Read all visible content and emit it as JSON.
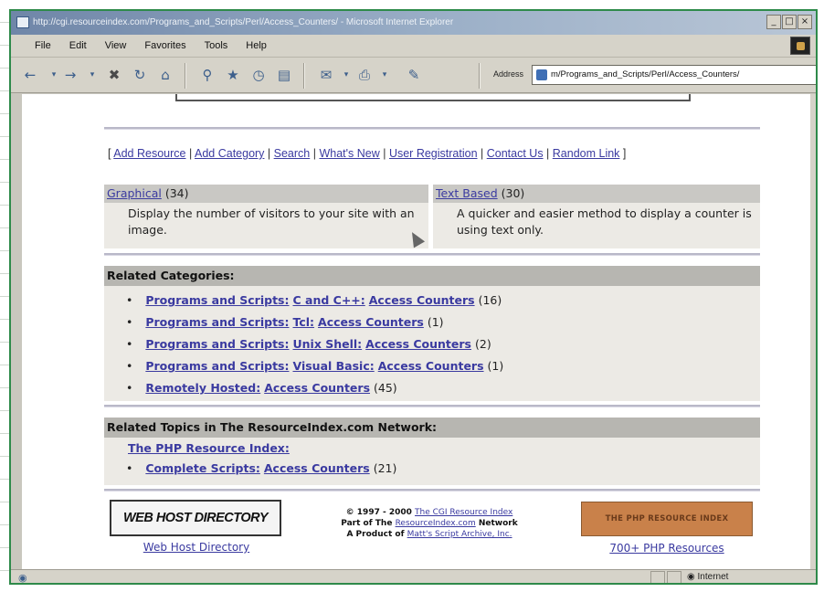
{
  "window": {
    "title": "http://cgi.resourceindex.com/Programs_and_Scripts/Perl/Access_Counters/ - Microsoft Internet Explorer",
    "controls": [
      "_",
      "□",
      "×"
    ]
  },
  "menu": [
    "File",
    "Edit",
    "View",
    "Favorites",
    "Tools",
    "Help"
  ],
  "toolbar": {
    "address_label": "Address",
    "address_value": "m/Programs_and_Scripts/Perl/Access_Counters/"
  },
  "nav_links": {
    "add_resource": "Add Resource",
    "add_category": "Add Category",
    "search": "Search",
    "whats_new": "What's New",
    "user_registration": "User Registration",
    "contact_us": "Contact Us",
    "random_link": "Random Link"
  },
  "categories": [
    {
      "name": "Graphical",
      "count": "(34)",
      "description": "Display the number of visitors to your site with an image."
    },
    {
      "name": "Text Based",
      "count": "(30)",
      "description": "A quicker and easier method to display a counter is using text only."
    }
  ],
  "related_categories": {
    "heading": "Related Categories:",
    "items": [
      {
        "parent": "Programs and Scripts:",
        "sub": "C and C++:",
        "link": "Access Counters",
        "count": "(16)"
      },
      {
        "parent": "Programs and Scripts:",
        "sub": "Tcl:",
        "link": "Access Counters",
        "count": "(1)"
      },
      {
        "parent": "Programs and Scripts:",
        "sub": "Unix Shell:",
        "link": "Access Counters",
        "count": "(2)"
      },
      {
        "parent": "Programs and Scripts:",
        "sub": "Visual Basic:",
        "link": "Access Counters",
        "count": "(1)"
      },
      {
        "parent": "Remotely Hosted:",
        "sub": "",
        "link": "Access Counters",
        "count": "(45)"
      }
    ]
  },
  "related_topics": {
    "heading": "Related Topics in The ResourceIndex.com Network:",
    "site": "The PHP Resource Index:",
    "items": [
      {
        "parent": "Complete Scripts:",
        "link": "Access Counters",
        "count": "(21)"
      }
    ]
  },
  "footer": {
    "left_logo": "WEB HOST DIRECTORY",
    "left_caption": "Web Host Directory",
    "copyright": "© 1997 - 2000",
    "copyright_link": "The CGI Resource Index",
    "part_of": "Part of The",
    "part_of_link": "ResourceIndex.com",
    "network": "Network",
    "product_of": "A Product of",
    "product_link": "Matt's Script Archive, Inc.",
    "right_logo": "THE PHP RESOURCE INDEX",
    "right_caption": "700+ PHP Resources"
  },
  "status": {
    "zone": "Internet"
  }
}
